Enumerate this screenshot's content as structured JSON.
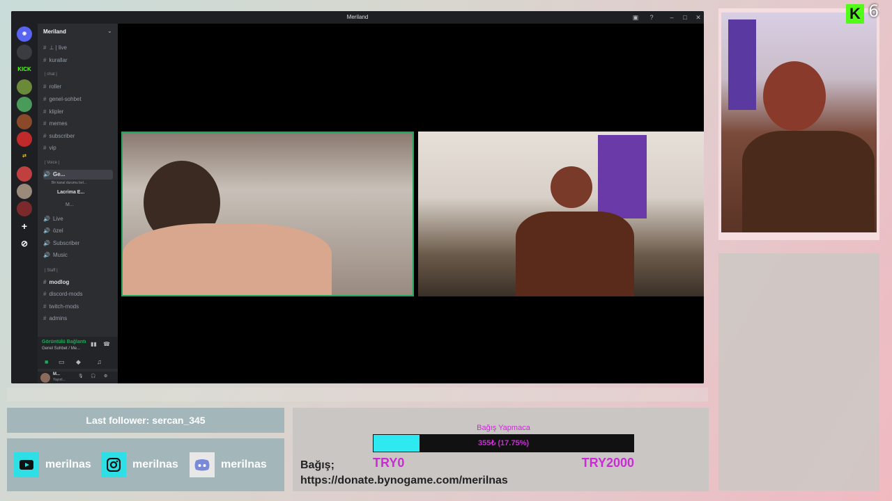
{
  "discord": {
    "window_title": "Meriland",
    "server_name": "Meriland",
    "channels": [
      {
        "prefix": "#",
        "label": "⊥ | live"
      },
      {
        "prefix": "#",
        "label": "kurallar"
      },
      {
        "prefix": "",
        "label": "| chat |",
        "category": true
      },
      {
        "prefix": "#",
        "label": "roller"
      },
      {
        "prefix": "#",
        "label": "genel-sohbet"
      },
      {
        "prefix": "#",
        "label": "klipler"
      },
      {
        "prefix": "#",
        "label": "memes"
      },
      {
        "prefix": "#",
        "label": "subscriber"
      },
      {
        "prefix": "#",
        "label": "vip"
      },
      {
        "prefix": "",
        "label": "| Voice |",
        "category": true
      },
      {
        "prefix": "🔊",
        "label": "Ge...",
        "bold": true
      },
      {
        "prefix": "",
        "label": "Bir kanal durumu bel..."
      },
      {
        "prefix": "",
        "label": "Lacrima E..."
      },
      {
        "prefix": "",
        "label": "M..."
      },
      {
        "prefix": "🔊",
        "label": "Live"
      },
      {
        "prefix": "🔊",
        "label": "özel"
      },
      {
        "prefix": "🔊",
        "label": "Subscriber"
      },
      {
        "prefix": "🔊",
        "label": "Music"
      },
      {
        "prefix": "",
        "label": "| Staff |",
        "category": true
      },
      {
        "prefix": "#",
        "label": "modlog",
        "bold": true
      },
      {
        "prefix": "#",
        "label": "discord-mods"
      },
      {
        "prefix": "#",
        "label": "twitch-mods"
      },
      {
        "prefix": "#",
        "label": "admins"
      }
    ],
    "voice_status": "Görüntülü Bağlantı",
    "voice_channel": "Genel Sohbet / Me...",
    "user_name": "M...",
    "user_status": "Yayınl..."
  },
  "overlay": {
    "last_follower": "Last follower: sercan_345",
    "socials": [
      {
        "icon": "youtube-icon",
        "handle": "merilnas"
      },
      {
        "icon": "instagram-icon",
        "handle": "merilnas"
      },
      {
        "icon": "discord-icon",
        "handle": "merilnas"
      }
    ],
    "donation": {
      "title": "Bağış Yapmaca",
      "progress_text": "355₺ (17.75%)",
      "progress_fraction": 0.1775,
      "min": "TRY0",
      "max": "TRY2000",
      "label": "Bağış;",
      "url": "https://donate.bynogame.com/merilnas"
    },
    "brand_number": "6",
    "colors": {
      "accent_cyan": "#2eeaf0",
      "accent_magenta": "#cc2ad9",
      "kick_green": "#53fc18",
      "speaking_green": "#23a55a"
    }
  }
}
